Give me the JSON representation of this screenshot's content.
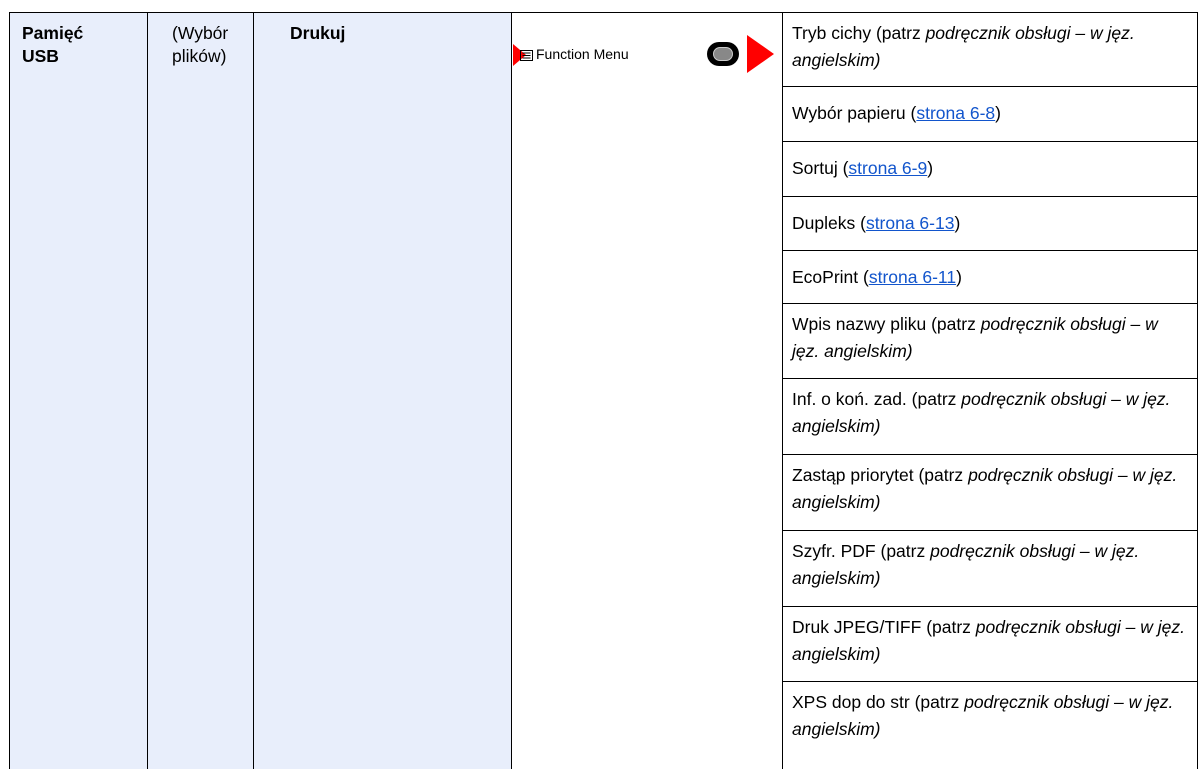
{
  "columns": {
    "col1": {
      "line1": "Pamięć",
      "line2": "USB"
    },
    "col2": {
      "line1": "(Wybór",
      "line2": "plików)"
    },
    "col3": {
      "label": "Drukuj"
    }
  },
  "function_menu": {
    "label": "Function Menu"
  },
  "colors": {
    "band": "#e8eefb",
    "arrow": "#ff0000",
    "link": "#1255cc"
  },
  "options": [
    {
      "name": "Tryb cichy",
      "ref_prefix": "(patrz ",
      "ref_italic": "podręcznik obsługi",
      "ref_suffix": " – w jęz. angielskim)"
    },
    {
      "name": "Wybór papieru",
      "open": "(",
      "link": "strona 6-8",
      "close": ")"
    },
    {
      "name": "Sortuj",
      "open": "(",
      "link": "strona 6-9",
      "close": ")"
    },
    {
      "name": "Dupleks",
      "open": "(",
      "link": "strona 6-13",
      "close": ")"
    },
    {
      "name": "EcoPrint",
      "open": "(",
      "link": "strona 6-11",
      "close": ")"
    },
    {
      "name": "Wpis nazwy pliku",
      "ref_prefix": "(patrz ",
      "ref_italic": "podręcznik obsługi",
      "ref_suffix": " – w jęz. angielskim)"
    },
    {
      "name": "Inf. o koń. zad.",
      "ref_prefix": "(patrz ",
      "ref_italic": "podręcznik obsługi",
      "ref_suffix": " – w jęz. angielskim)"
    },
    {
      "name": "Zastąp priorytet",
      "ref_prefix": "(patrz ",
      "ref_italic": "podręcznik obsługi",
      "ref_suffix": " – w jęz. angielskim)"
    },
    {
      "name": "Szyfr. PDF",
      "ref_prefix": "(patrz ",
      "ref_italic": "podręcznik obsługi",
      "ref_suffix": " – w jęz. angielskim)"
    },
    {
      "name": "Druk JPEG/TIFF",
      "ref_prefix": "(patrz ",
      "ref_italic": "podręcznik obsługi",
      "ref_suffix": " – w jęz. angielskim)"
    },
    {
      "name": "XPS dop do str",
      "ref_prefix": "(patrz ",
      "ref_italic": "podręcznik obsługi",
      "ref_suffix": " – w jęz. angielskim)"
    }
  ]
}
